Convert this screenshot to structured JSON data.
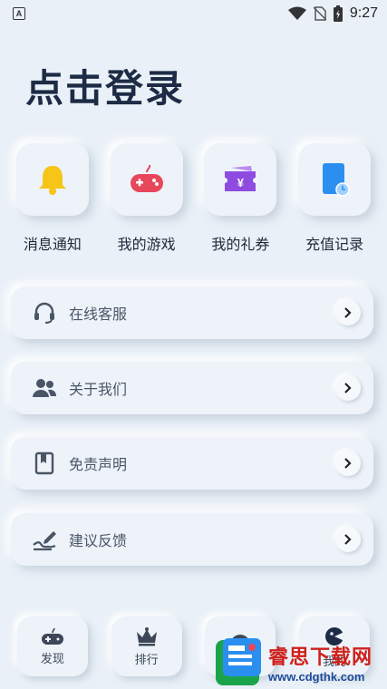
{
  "status_bar": {
    "badge": "A",
    "time": "9:27"
  },
  "header": {
    "title": "点击登录"
  },
  "quick_actions": [
    {
      "label": "消息通知",
      "icon": "bell-icon"
    },
    {
      "label": "我的游戏",
      "icon": "gamepad-icon"
    },
    {
      "label": "我的礼券",
      "icon": "coupon-icon"
    },
    {
      "label": "充值记录",
      "icon": "recharge-record-icon"
    }
  ],
  "coupon_symbol": "¥",
  "menu": [
    {
      "label": "在线客服",
      "icon": "headset-icon"
    },
    {
      "label": "关于我们",
      "icon": "users-icon"
    },
    {
      "label": "免责声明",
      "icon": "book-icon"
    },
    {
      "label": "建议反馈",
      "icon": "feedback-pen-icon"
    }
  ],
  "bottom_nav": [
    {
      "label": "发现",
      "icon": "gamepad-icon"
    },
    {
      "label": "排行",
      "icon": "crown-icon"
    },
    {
      "label": "",
      "icon": "smiley-icon"
    },
    {
      "label": "我的",
      "icon": "profile-icon"
    }
  ],
  "watermark": {
    "name": "睿思下载网",
    "url": "www.cdgthk.com"
  },
  "colors": {
    "background": "#e9f0f7",
    "bell": "#f5c518",
    "gamepad": "#e8465a",
    "coupon": "#8e4be0",
    "recharge": "#2b8ff0"
  }
}
